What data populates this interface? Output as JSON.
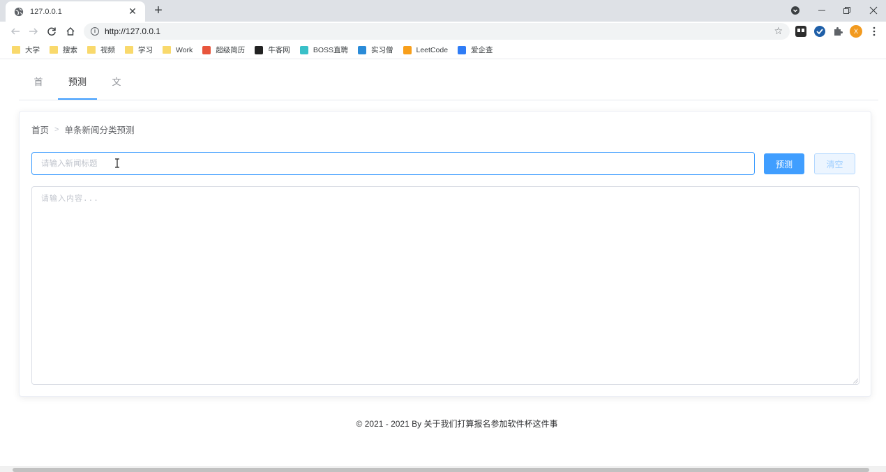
{
  "browser": {
    "tab_title": "127.0.0.1",
    "tab_close": "✕",
    "new_tab": "+",
    "url": "http://127.0.0.1",
    "profile_initial": "X",
    "bookmarks": [
      {
        "label": "大学",
        "icon": "folder-icon"
      },
      {
        "label": "搜索",
        "icon": "folder-icon"
      },
      {
        "label": "视频",
        "icon": "folder-icon"
      },
      {
        "label": "学习",
        "icon": "folder-icon"
      },
      {
        "label": "Work",
        "icon": "folder-icon"
      },
      {
        "label": "超级简历",
        "icon": "site-icon",
        "color": "#e8553c"
      },
      {
        "label": "牛客网",
        "icon": "site-icon",
        "color": "#222222"
      },
      {
        "label": "BOSS直聘",
        "icon": "site-icon",
        "color": "#39c0c8"
      },
      {
        "label": "实习僧",
        "icon": "site-icon",
        "color": "#2a8bd8"
      },
      {
        "label": "LeetCode",
        "icon": "site-icon",
        "color": "#f89f1b"
      },
      {
        "label": "爱企查",
        "icon": "site-icon",
        "color": "#2f7cf6"
      }
    ]
  },
  "nav": {
    "items": [
      "首页",
      "预测",
      "文件"
    ],
    "active_index": 1
  },
  "breadcrumb": {
    "home": "首页",
    "separator": ">",
    "current": "单条新闻分类预测"
  },
  "form": {
    "title_placeholder": "请输入新闻标题",
    "content_placeholder": "请输入内容...",
    "predict_label": "预测",
    "clear_label": "清空"
  },
  "footer": {
    "text": "© 2021 - 2021 By 关于我们打算报名参加软件杯这件事"
  },
  "colors": {
    "primary": "#409eff",
    "chrome_bg": "#dee1e6"
  }
}
